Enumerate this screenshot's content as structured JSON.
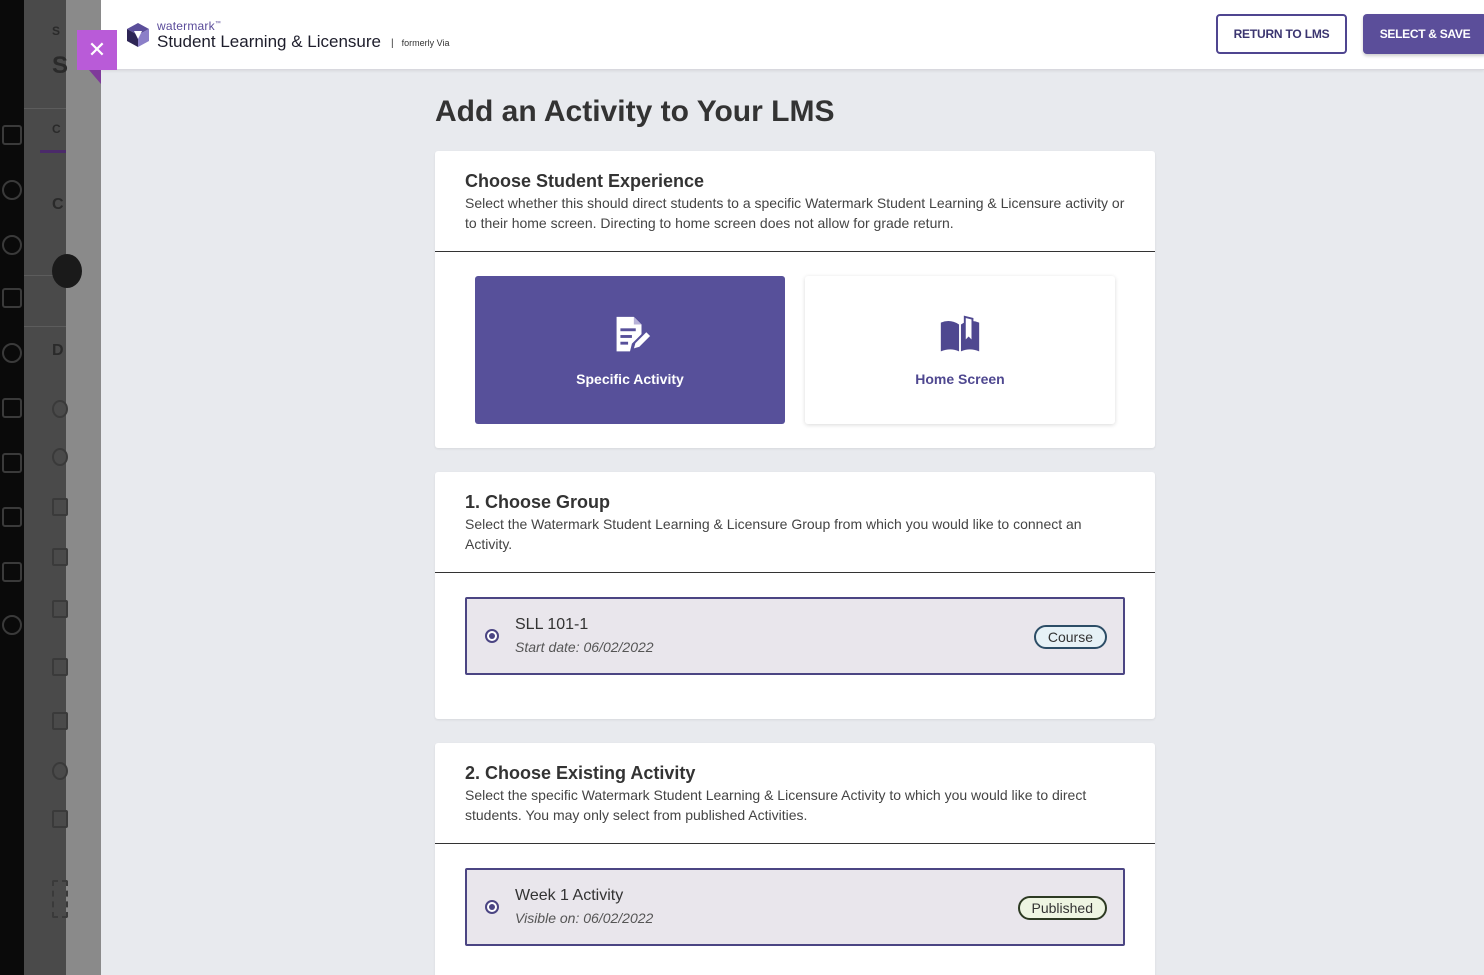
{
  "window": {
    "close_glyph": "✕"
  },
  "background_lms": {
    "letters": [
      "S",
      "S",
      "C",
      "C",
      "D"
    ]
  },
  "header": {
    "brand_top": "watermark",
    "brand_tm": "™",
    "brand_main": "Student Learning & Licensure",
    "brand_separator": "|",
    "brand_formerly": "formerly Via",
    "return_button": "RETURN TO LMS",
    "save_button": "SELECT & SAVE"
  },
  "page": {
    "title": "Add an Activity to Your LMS"
  },
  "experience": {
    "title": "Choose Student Experience",
    "description": "Select whether this should direct students to a specific Watermark Student Learning & Licensure activity or to their home screen. Directing to home screen does not allow for grade return.",
    "options": [
      {
        "label": "Specific Activity",
        "icon": "document-edit-icon",
        "selected": true
      },
      {
        "label": "Home Screen",
        "icon": "open-book-icon",
        "selected": false
      }
    ]
  },
  "group": {
    "title": "1. Choose Group",
    "description": "Select the Watermark Student Learning & Licensure Group from which you would like to connect an Activity.",
    "item": {
      "name": "SLL 101-1",
      "sub": "Start date: 06/02/2022",
      "badge": "Course",
      "selected": true
    }
  },
  "activity": {
    "title": "2. Choose Existing Activity",
    "description": "Select the specific Watermark Student Learning & Licensure Activity to which you would like to direct students. You may only select from published Activities.",
    "item": {
      "name": "Week 1 Activity",
      "sub": "Visible on: 06/02/2022",
      "badge": "Published",
      "selected": true
    }
  },
  "colors": {
    "accent": "#5b4e9a",
    "close_button": "#b95bd8",
    "page_bg": "#e8eaee"
  }
}
